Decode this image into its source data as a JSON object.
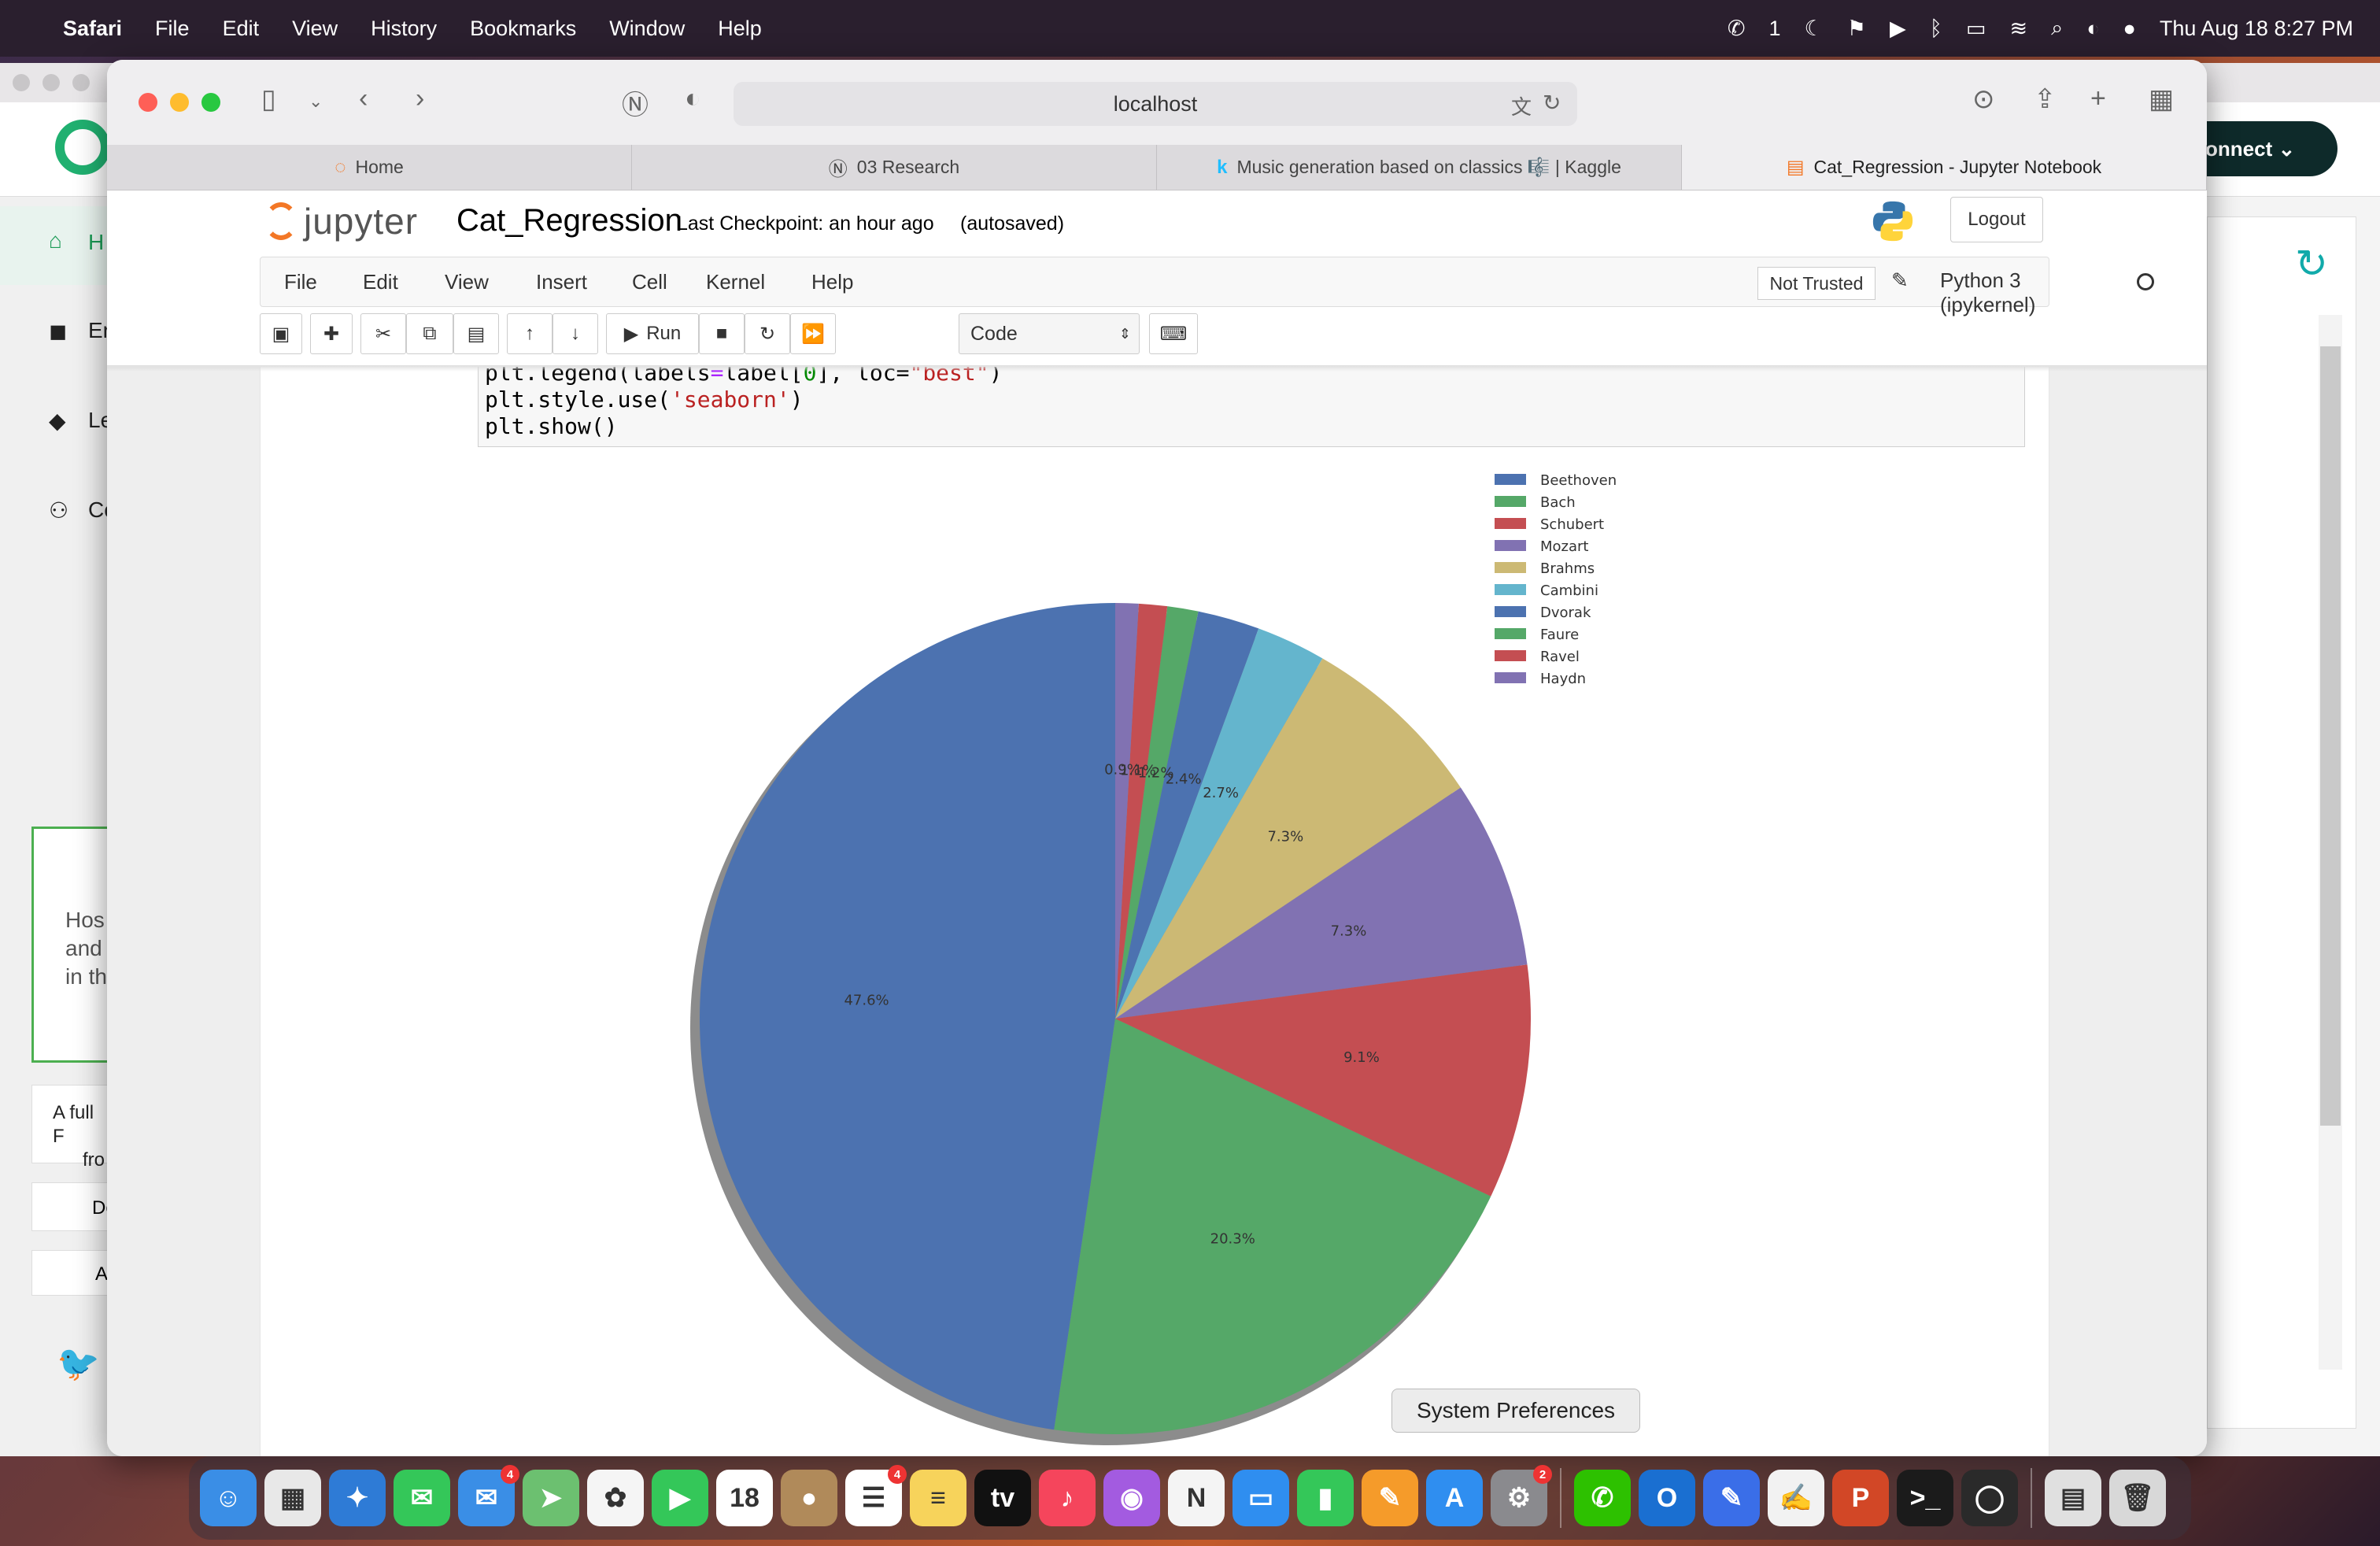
{
  "menubar": {
    "app": "Safari",
    "items": [
      "File",
      "Edit",
      "View",
      "History",
      "Bookmarks",
      "Window",
      "Help"
    ],
    "wechat_count": "1",
    "datetime": "Thu Aug 18  8:27 PM"
  },
  "background_page": {
    "connect_label": "onnect",
    "sidebar": [
      "H",
      "Er",
      "Le",
      "Co"
    ],
    "card_text": [
      "Hos",
      "and",
      "in th"
    ],
    "card2_text": [
      "A full F",
      "fro"
    ],
    "btn1": "De",
    "btn2": "A"
  },
  "safari": {
    "url": "localhost",
    "tabs": [
      {
        "label": "Home",
        "icon": "jupyter-icon"
      },
      {
        "label": "03 Research",
        "icon": "notion-icon"
      },
      {
        "label": "Music generation based on classics 🎼 | Kaggle",
        "icon": "kaggle-icon"
      },
      {
        "label": "Cat_Regression - Jupyter Notebook",
        "icon": "notebook-icon"
      }
    ]
  },
  "jupyter": {
    "logo_text": "jupyter",
    "notebook_name": "Cat_Regression",
    "checkpoint": "Last Checkpoint: an hour ago",
    "autosaved": "(autosaved)",
    "logout": "Logout",
    "menu": [
      "File",
      "Edit",
      "View",
      "Insert",
      "Cell",
      "Kernel",
      "Help"
    ],
    "trust": "Not Trusted",
    "kernel": "Python 3 (ipykernel)",
    "run_label": "Run",
    "cell_type": "Code",
    "code_lines": [
      {
        "a": "plt.legend(labels",
        "op": "=",
        "b": "label[",
        "n": "0",
        "c": "], loc=",
        "s": "\"best\"",
        "d": ")"
      },
      {
        "a": "plt.style.use(",
        "s": "'seaborn'",
        "d": ")"
      },
      {
        "a": "plt.show()"
      }
    ]
  },
  "tooltip": "System Preferences",
  "chart_data": {
    "type": "pie",
    "categories": [
      "Beethoven",
      "Bach",
      "Schubert",
      "Mozart",
      "Brahms",
      "Cambini",
      "Dvorak",
      "Faure",
      "Ravel",
      "Haydn"
    ],
    "values": [
      47.6,
      20.3,
      9.1,
      7.3,
      7.3,
      2.7,
      2.4,
      1.2,
      1.1,
      0.9
    ],
    "labels": [
      "47.6%",
      "20.3%",
      "9.1%",
      "7.3%",
      "7.3%",
      "2.7%",
      "2.4%",
      "1.2%",
      "1.1%",
      "0.9%"
    ],
    "colors": [
      "#4c72b0",
      "#55a868",
      "#c44e52",
      "#8172b2",
      "#ccb974",
      "#64b5cd",
      "#4c72b0",
      "#55a868",
      "#c44e52",
      "#8172b2"
    ],
    "start_angle_deg": 90,
    "direction": "counterclockwise",
    "shadow": true,
    "legend_location": "best (top-right)",
    "title": ""
  },
  "dock": {
    "apps": [
      {
        "name": "finder",
        "color": "#3a8ee6",
        "glyph": "☺"
      },
      {
        "name": "launchpad",
        "color": "#e8e8e8",
        "glyph": "▦"
      },
      {
        "name": "safari",
        "color": "#2e7bd6",
        "glyph": "✦"
      },
      {
        "name": "messages",
        "color": "#34c759",
        "glyph": "✉"
      },
      {
        "name": "mail",
        "color": "#3a8ee6",
        "glyph": "✉",
        "badge": "4"
      },
      {
        "name": "maps",
        "color": "#6cc070",
        "glyph": "➤"
      },
      {
        "name": "photos",
        "color": "#f5f5f5",
        "glyph": "✿"
      },
      {
        "name": "facetime",
        "color": "#34c759",
        "glyph": "▶"
      },
      {
        "name": "calendar",
        "color": "#ffffff",
        "glyph": "18"
      },
      {
        "name": "contacts",
        "color": "#b08a5a",
        "glyph": "●"
      },
      {
        "name": "reminders",
        "color": "#ffffff",
        "glyph": "☰",
        "badge": "4"
      },
      {
        "name": "notes",
        "color": "#f7d35b",
        "glyph": "≡"
      },
      {
        "name": "tv",
        "color": "#111111",
        "glyph": "tv"
      },
      {
        "name": "music",
        "color": "#f5455c",
        "glyph": "♪"
      },
      {
        "name": "podcasts",
        "color": "#a35be0",
        "glyph": "◉"
      },
      {
        "name": "news",
        "color": "#f4f4f4",
        "glyph": "N"
      },
      {
        "name": "keynote",
        "color": "#2f8ef0",
        "glyph": "▭"
      },
      {
        "name": "numbers",
        "color": "#34c759",
        "glyph": "▮"
      },
      {
        "name": "pages",
        "color": "#f59b2a",
        "glyph": "✎"
      },
      {
        "name": "app-store",
        "color": "#2f8ef0",
        "glyph": "A"
      },
      {
        "name": "system-preferences",
        "color": "#8a8a8e",
        "glyph": "⚙",
        "badge": "2"
      },
      {
        "name": "wechat",
        "color": "#2dc100",
        "glyph": "✆"
      },
      {
        "name": "outlook",
        "color": "#1a6fd1",
        "glyph": "O"
      },
      {
        "name": "xcode-pen",
        "color": "#3a6ee8",
        "glyph": "✎"
      },
      {
        "name": "textedit",
        "color": "#f2f2f2",
        "glyph": "✍"
      },
      {
        "name": "powerpoint",
        "color": "#d24726",
        "glyph": "P"
      },
      {
        "name": "terminal",
        "color": "#1b1b1b",
        "glyph": ">_"
      },
      {
        "name": "jupyter-ring",
        "color": "#2a2a2a",
        "glyph": "◯"
      },
      {
        "name": "documents",
        "color": "#e0e0e0",
        "glyph": "▤"
      },
      {
        "name": "trash",
        "color": "#d8d8d8",
        "glyph": "🗑"
      }
    ]
  }
}
